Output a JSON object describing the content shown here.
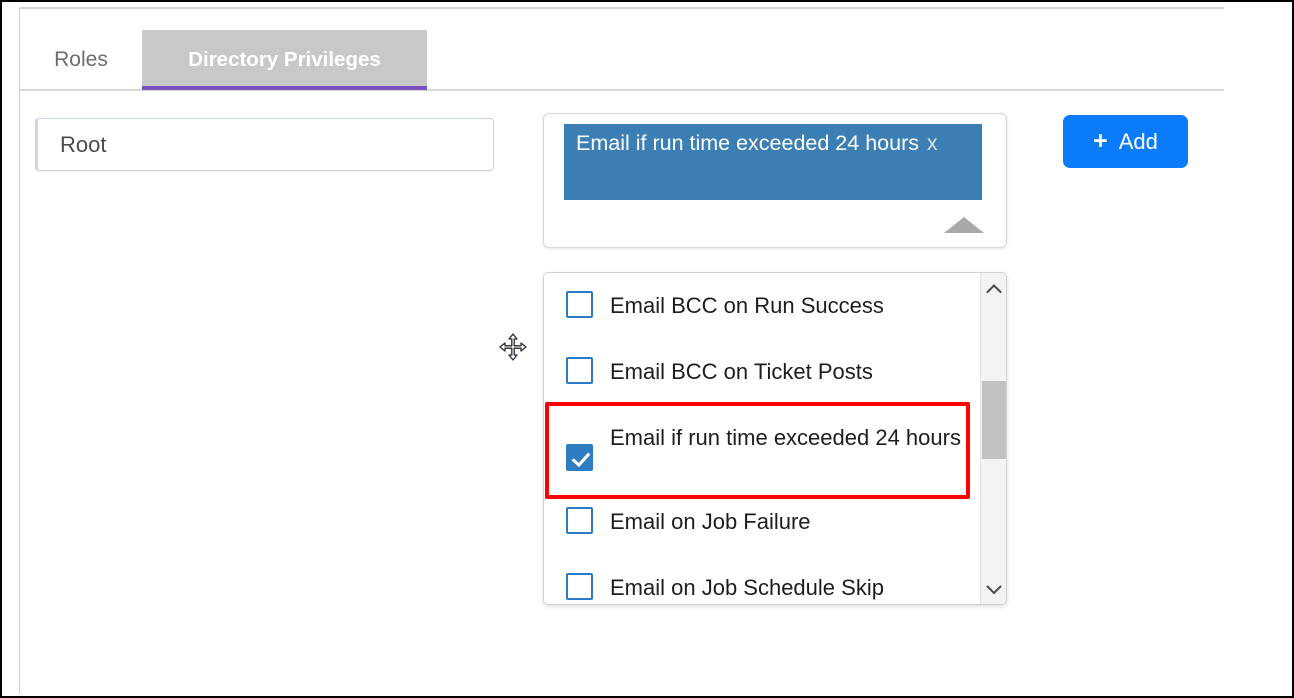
{
  "window": {
    "frame_color": "#000000",
    "background": "#ffffff"
  },
  "tabs": {
    "active_index": 1,
    "active_underline_color": "#7b4fc4",
    "active_background": "#c8c8c8",
    "items": [
      {
        "label": "Roles"
      },
      {
        "label": "Directory Privileges"
      }
    ]
  },
  "form": {
    "root_field": {
      "value": "Root",
      "placeholder": "Root"
    },
    "multiselect": {
      "selected_chips": [
        {
          "label": "Email if run time exceeded 24 hours",
          "remove_glyph": "x"
        }
      ],
      "chip_background": "#3b7fb5",
      "caret": "caret-up-icon",
      "expanded": true
    },
    "add_button": {
      "label": "Add",
      "plus_glyph": "+",
      "color": "#0a7cfa"
    }
  },
  "dropdown": {
    "items": [
      {
        "label": "Email BCC on Run Success",
        "checked": false,
        "highlighted": false
      },
      {
        "label": "Email BCC on Ticket Posts",
        "checked": false,
        "highlighted": false
      },
      {
        "label": "Email if run time exceeded 24 hours",
        "checked": true,
        "highlighted": true
      },
      {
        "label": "Email on Job Failure",
        "checked": false,
        "highlighted": false
      },
      {
        "label": "Email on Job Schedule Skip",
        "checked": false,
        "highlighted": false
      }
    ],
    "checkbox_color": "#2e7dc0",
    "highlight_color": "#fb0000",
    "scrollbar": {
      "up_arrow": "chevron-up-icon",
      "down_arrow": "chevron-down-icon",
      "thumb_color": "#c2c2c2"
    }
  },
  "cursor": {
    "type": "move-cursor"
  }
}
